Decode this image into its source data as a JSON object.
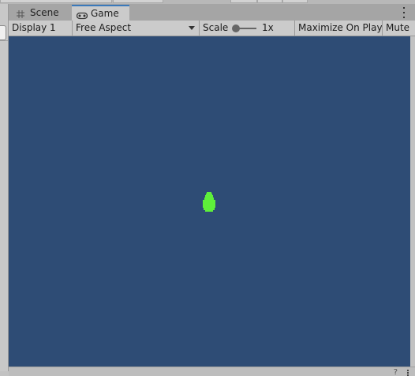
{
  "tabs": [
    {
      "label": "Scene",
      "icon": "grid-icon",
      "active": false
    },
    {
      "label": "Game",
      "icon": "gamepad-icon",
      "active": true
    }
  ],
  "toolbar": {
    "display": "Display 1",
    "aspect": "Free Aspect",
    "scale_label": "Scale",
    "scale_value": "1x",
    "maximize": "Maximize On Play",
    "mute": "Mute"
  },
  "game_view": {
    "background": "#2e4c75",
    "sprite_color": "#5ef03a",
    "sprite": "green-droplet-sprite"
  },
  "colors": {
    "panel": "#cbcbcb",
    "tab_active_accent": "#3a79bb"
  }
}
